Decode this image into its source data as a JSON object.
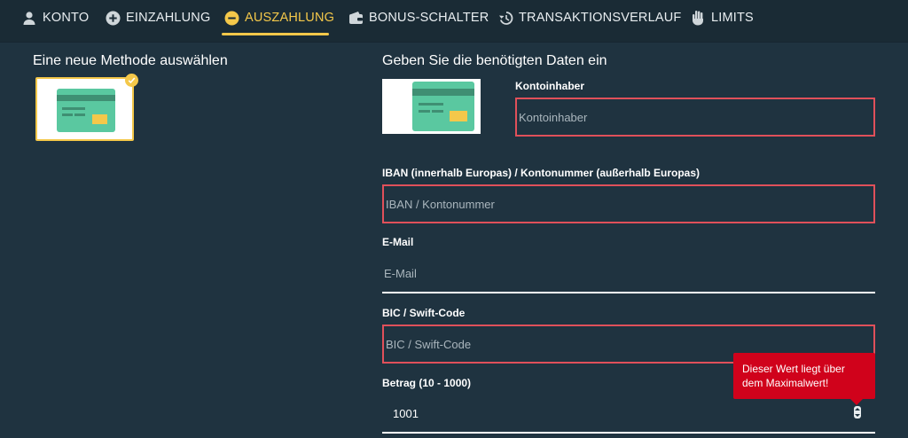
{
  "nav": {
    "items": [
      {
        "label": "KONTO",
        "icon": "user-icon"
      },
      {
        "label": "EINZAHLUNG",
        "icon": "plus-circle-icon"
      },
      {
        "label": "AUSZAHLUNG",
        "icon": "minus-circle-icon",
        "active": true
      },
      {
        "label": "BONUS-SCHALTER",
        "icon": "wallet-icon"
      },
      {
        "label": "TRANSAKTIONSVERLAUF",
        "icon": "history-icon"
      },
      {
        "label": "LIMITS",
        "icon": "hand-icon"
      }
    ]
  },
  "left": {
    "heading": "Eine neue Methode auswählen"
  },
  "right": {
    "heading": "Geben Sie die benötigten Daten ein"
  },
  "form": {
    "kontoinhaber": {
      "label": "Kontoinhaber",
      "placeholder": "Kontoinhaber",
      "value": ""
    },
    "iban": {
      "label": "IBAN (innerhalb Europas) / Kontonummer (außerhalb Europas)",
      "placeholder": "IBAN / Kontonummer",
      "value": ""
    },
    "email": {
      "label": "E-Mail",
      "placeholder": "E-Mail",
      "value": ""
    },
    "bic": {
      "label": "BIC / Swift-Code",
      "placeholder": "BIC / Swift-Code",
      "value": ""
    },
    "betrag": {
      "label": "Betrag (10 - 1000)",
      "value": "1001"
    }
  },
  "tooltip": {
    "text": "Dieser Wert liegt über dem Maximalwert!"
  },
  "colors": {
    "accent": "#f4c84a",
    "background": "#1f3340",
    "error": "#e0505a",
    "tooltip": "#d0021b",
    "card": "#5ac8a0"
  }
}
